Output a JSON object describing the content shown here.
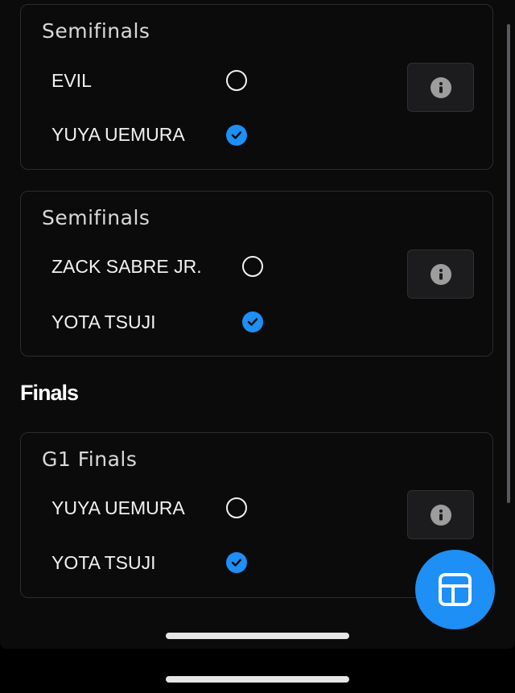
{
  "matches": [
    {
      "title": "Semifinals",
      "options": [
        {
          "label": "EVIL",
          "selected": false
        },
        {
          "label": "YUYA UEMURA",
          "selected": true
        }
      ]
    },
    {
      "title": "Semifinals",
      "options": [
        {
          "label": "ZACK SABRE JR.",
          "selected": false
        },
        {
          "label": "YOTA TSUJI",
          "selected": true
        }
      ]
    },
    {
      "title": "G1 Finals",
      "options": [
        {
          "label": "YUYA UEMURA",
          "selected": false
        },
        {
          "label": "YOTA TSUJI",
          "selected": true
        }
      ]
    }
  ],
  "section": {
    "finals_heading": "Finals"
  },
  "icons": {
    "info": "info-icon",
    "check": "checkmark-icon",
    "fab": "table-grid-icon"
  },
  "colors": {
    "accent": "#1e8ff5",
    "background": "#0b0b0c",
    "card_border": "#2c2c2f",
    "text": "#f2f2f2"
  }
}
